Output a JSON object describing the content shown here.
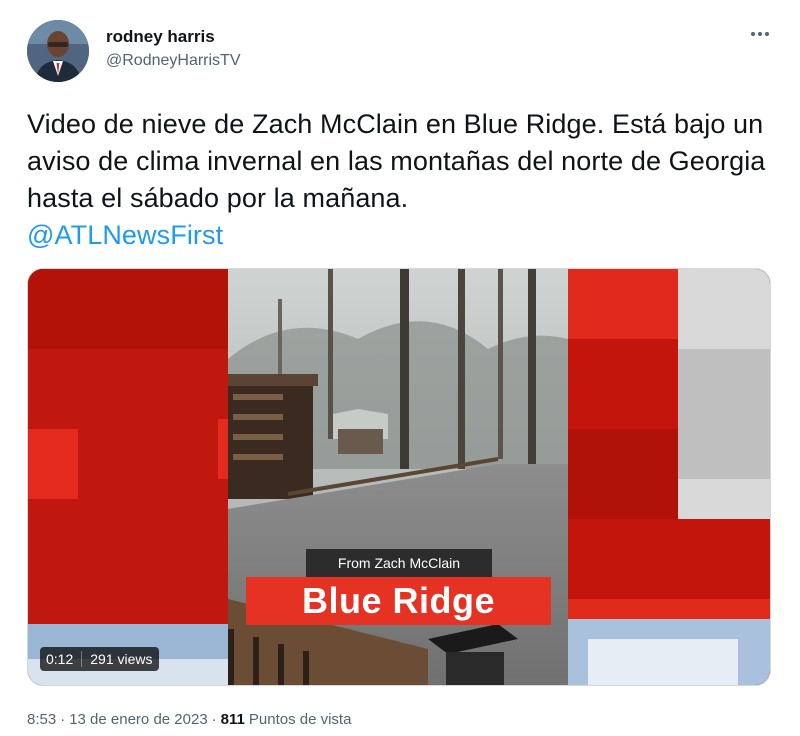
{
  "author": {
    "name": "rodney harris",
    "handle": "@RodneyHarrisTV"
  },
  "tweet": {
    "text": "Video de nieve de Zach McClain en Blue Ridge. Está bajo un aviso de clima invernal en las montañas del norte de Georgia hasta el sábado por la mañana.",
    "mention": "@ATLNewsFirst"
  },
  "video": {
    "subtitle": "From Zach McClain",
    "title": "Blue Ridge",
    "duration": "0:12",
    "views": "291 views"
  },
  "meta": {
    "time": "8:53",
    "dot1": "·",
    "date": "13 de enero de 2023",
    "dot2": "·",
    "view_count": "811",
    "view_label": "Puntos de vista"
  },
  "icons": {
    "more": "more-options-icon"
  },
  "colors": {
    "accent": "#1d9bf0",
    "brand_red": "#e53223"
  }
}
